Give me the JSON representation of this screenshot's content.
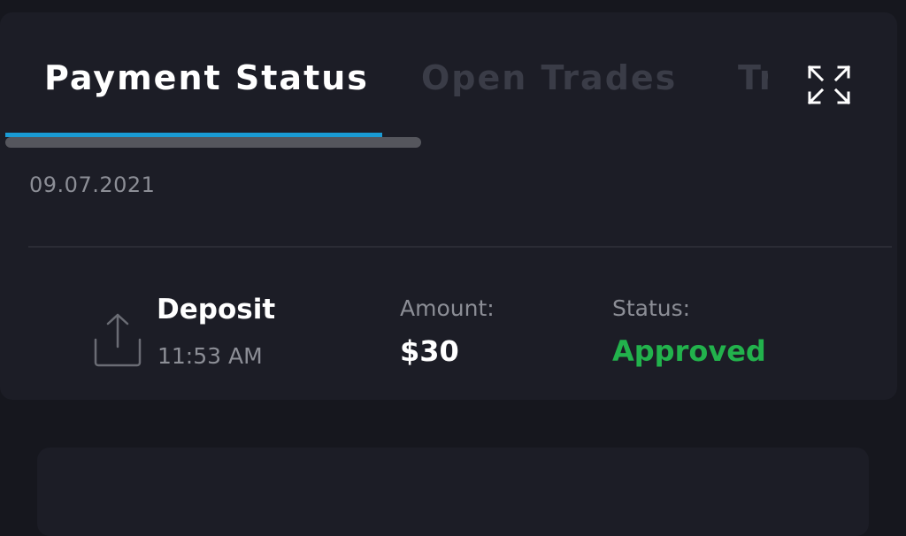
{
  "tabs": [
    {
      "label": "Payment Status",
      "active": true
    },
    {
      "label": "Open Trades",
      "active": false
    },
    {
      "label": "Trades",
      "active": false
    }
  ],
  "expand_icon": "expand-arrows-icon",
  "payment": {
    "date": "09.07.2021",
    "type": "Deposit",
    "time": "11:53 AM",
    "amount_label": "Amount:",
    "amount": "$30",
    "status_label": "Status:",
    "status": "Approved",
    "type_icon": "upload-icon"
  },
  "colors": {
    "accent": "#1a9bd4",
    "status_approved": "#22b24c",
    "background": "#16171e",
    "panel": "#1c1d26"
  }
}
